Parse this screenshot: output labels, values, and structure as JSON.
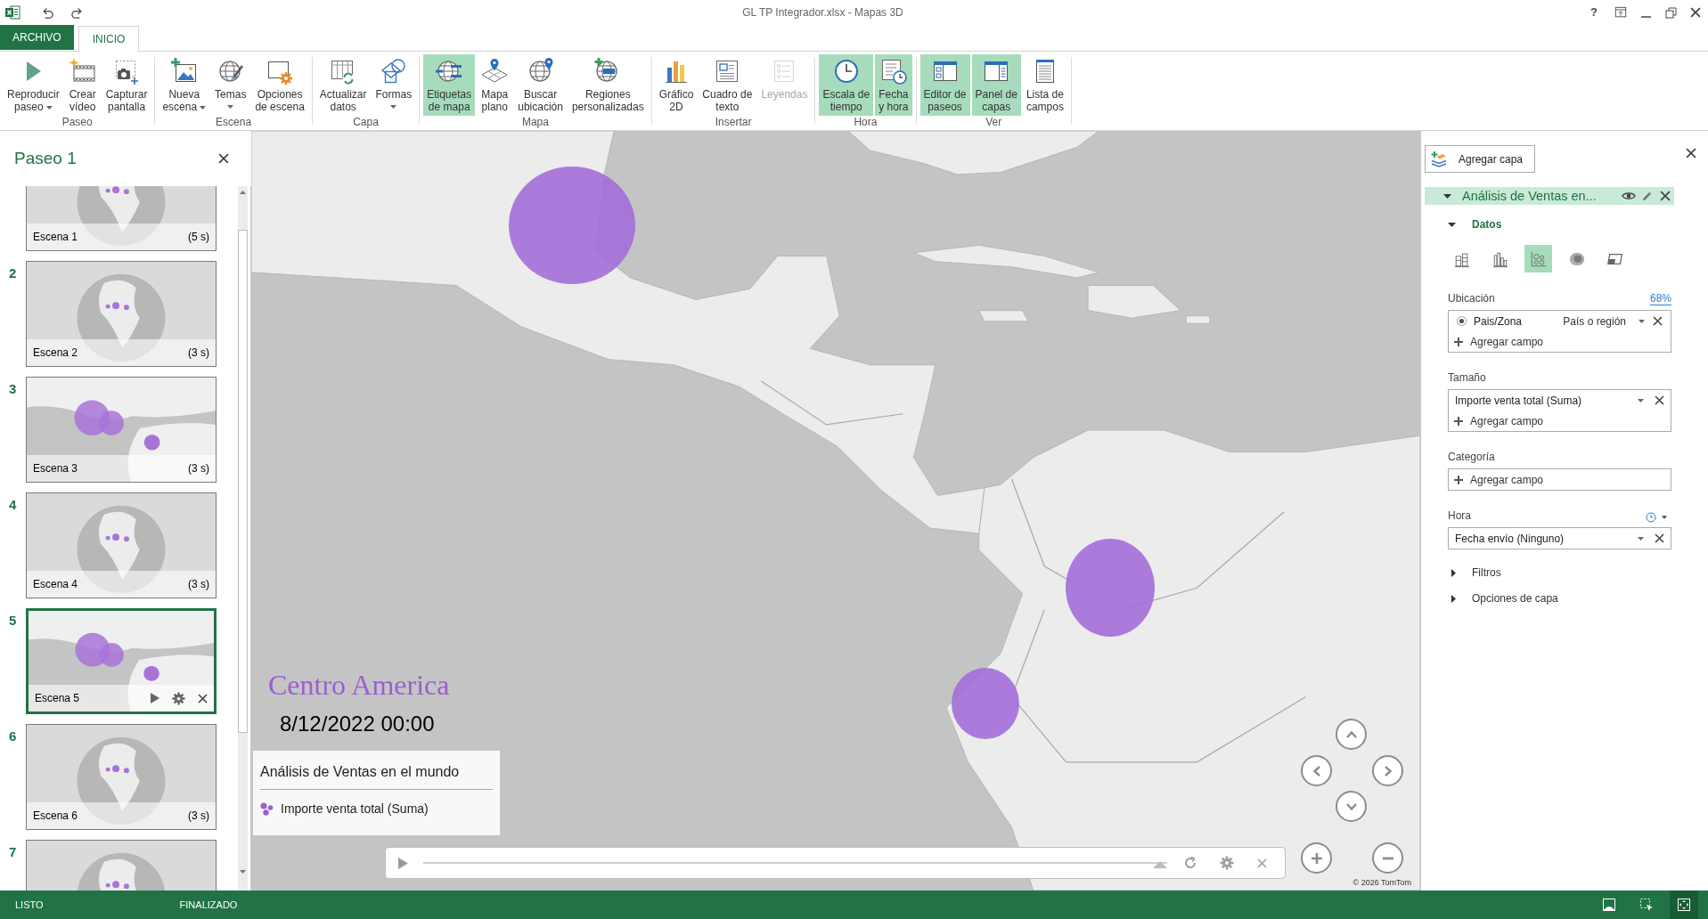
{
  "window": {
    "title": "GL TP Integrador.xlsx - Mapas 3D",
    "help": "?"
  },
  "ribbon_tabs": [
    {
      "label": "ARCHIVO",
      "kind": "file",
      "selected": false
    },
    {
      "label": "INICIO",
      "kind": "tab",
      "selected": true
    }
  ],
  "ribbon_groups": [
    {
      "label": "Paseo",
      "buttons": [
        {
          "label": "Reproducir\npaseo",
          "kind": "play",
          "dropdown": true,
          "on": false,
          "disabled": false
        },
        {
          "label": "Crear\nvídeo",
          "kind": "video",
          "dropdown": false,
          "on": false,
          "disabled": false
        },
        {
          "label": "Capturar\npantalla",
          "kind": "camera",
          "dropdown": false,
          "on": false,
          "disabled": false
        }
      ]
    },
    {
      "label": "Escena",
      "buttons": [
        {
          "label": "Nueva\nescena",
          "kind": "new_scene",
          "dropdown": true,
          "on": false,
          "disabled": false
        },
        {
          "label": "Temas",
          "kind": "themes",
          "dropdown": true,
          "on": false,
          "disabled": false
        },
        {
          "label": "Opciones\nde escena",
          "kind": "scene_options",
          "dropdown": false,
          "on": false,
          "disabled": false
        }
      ]
    },
    {
      "label": "Capa",
      "buttons": [
        {
          "label": "Actualizar\ndatos",
          "kind": "refresh_data",
          "dropdown": false,
          "on": false,
          "disabled": false
        },
        {
          "label": "Formas",
          "kind": "shapes",
          "dropdown": true,
          "on": false,
          "disabled": false
        }
      ]
    },
    {
      "label": "Mapa",
      "buttons": [
        {
          "label": "Etiquetas\nde mapa",
          "kind": "map_labels",
          "dropdown": false,
          "on": true,
          "disabled": false
        },
        {
          "label": "Mapa\nplano",
          "kind": "flat_map",
          "dropdown": false,
          "on": false,
          "disabled": false
        },
        {
          "label": "Buscar\nubicación",
          "kind": "find_location",
          "dropdown": false,
          "on": false,
          "disabled": false
        },
        {
          "label": "Regiones\npersonalizadas",
          "kind": "custom_regions",
          "dropdown": false,
          "on": false,
          "disabled": false
        }
      ]
    },
    {
      "label": "Insertar",
      "buttons": [
        {
          "label": "Gráfico\n2D",
          "kind": "chart_2d",
          "dropdown": false,
          "on": false,
          "disabled": false
        },
        {
          "label": "Cuadro de\ntexto",
          "kind": "text_box",
          "dropdown": false,
          "on": false,
          "disabled": false
        },
        {
          "label": "Leyendas",
          "kind": "legend",
          "dropdown": false,
          "on": false,
          "disabled": true
        }
      ]
    },
    {
      "label": "Hora",
      "buttons": [
        {
          "label": "Escala de\ntiempo",
          "kind": "time_scale",
          "dropdown": false,
          "on": true,
          "disabled": false
        },
        {
          "label": "Fecha\ny hora",
          "kind": "date_time",
          "dropdown": false,
          "on": true,
          "disabled": false
        }
      ]
    },
    {
      "label": "Ver",
      "buttons": [
        {
          "label": "Editor de\npaseos",
          "kind": "tour_editor",
          "dropdown": false,
          "on": true,
          "disabled": false
        },
        {
          "label": "Panel de\ncapas",
          "kind": "layer_pane",
          "dropdown": false,
          "on": true,
          "disabled": false
        },
        {
          "label": "Lista de\ncampos",
          "kind": "field_list",
          "dropdown": false,
          "on": false,
          "disabled": false
        }
      ]
    }
  ],
  "tour_panel": {
    "title": "Paseo 1",
    "scenes": [
      {
        "label": "Escena 1",
        "duration": "(5 s)",
        "kind": "globe",
        "selected": false
      },
      {
        "number": "2",
        "label": "Escena 2",
        "duration": "(3 s)",
        "kind": "globe",
        "selected": false
      },
      {
        "number": "3",
        "label": "Escena 3",
        "duration": "(3 s)",
        "kind": "flat",
        "selected": false
      },
      {
        "number": "4",
        "label": "Escena 4",
        "duration": "(3 s)",
        "kind": "globe",
        "selected": false
      },
      {
        "number": "5",
        "label": "Escena 5",
        "kind": "flat",
        "selected": true
      },
      {
        "number": "6",
        "label": "Escena 6",
        "duration": "(3 s)",
        "kind": "globe",
        "selected": false
      },
      {
        "number": "7",
        "kind": "globe",
        "selected": false
      }
    ]
  },
  "map": {
    "scene_title": "Centro America",
    "date": "8/12/2022 00:00",
    "legend": {
      "title": "Análisis de Ventas en el mundo",
      "items": [
        {
          "label": "Importe venta total (Suma)"
        }
      ]
    },
    "playback": {
      "level": 0.99
    },
    "attribution": "© 2026 TomTom"
  },
  "layer_pane": {
    "add_layer": "Agregar capa",
    "layer": {
      "name": "Análisis de Ventas en...",
      "expanded": true
    },
    "section": {
      "label": "Datos",
      "expanded": true
    },
    "viz_types": [
      {
        "kind": "stacked",
        "selected": false
      },
      {
        "kind": "clustered",
        "selected": false
      },
      {
        "kind": "bubble",
        "selected": true
      },
      {
        "kind": "heatmap",
        "selected": false
      },
      {
        "kind": "region",
        "selected": false
      }
    ],
    "wells": [
      {
        "label": "Ubicación",
        "link": "68%",
        "kind": "list",
        "rows": [
          {
            "kind": "geo",
            "field": "Pais/Zona",
            "selected": true,
            "type": "País o región"
          },
          {
            "kind": "add",
            "label": "Agregar campo"
          }
        ]
      },
      {
        "label": "Tamaño",
        "kind": "list",
        "rows": [
          {
            "kind": "field",
            "field": "Importe venta total (Suma)"
          },
          {
            "kind": "add",
            "label": "Agregar campo"
          }
        ]
      },
      {
        "label": "Categoría",
        "kind": "list",
        "rows": [
          {
            "kind": "add",
            "label": "Agregar campo"
          }
        ]
      },
      {
        "label": "Hora",
        "kind": "time",
        "rows": [
          {
            "kind": "field",
            "field": "Fecha envío (Ninguno)"
          }
        ]
      }
    ],
    "more_sections": [
      {
        "label": "Filtros",
        "expanded": false
      },
      {
        "label": "Opciones de capa",
        "expanded": false
      }
    ]
  },
  "status_bar": {
    "texts": [
      "LISTO",
      "FINALIZADO"
    ],
    "view_buttons": [
      {
        "kind": "picture",
        "selected": false
      },
      {
        "kind": "select",
        "selected": false
      },
      {
        "kind": "fit",
        "selected": true
      }
    ]
  }
}
